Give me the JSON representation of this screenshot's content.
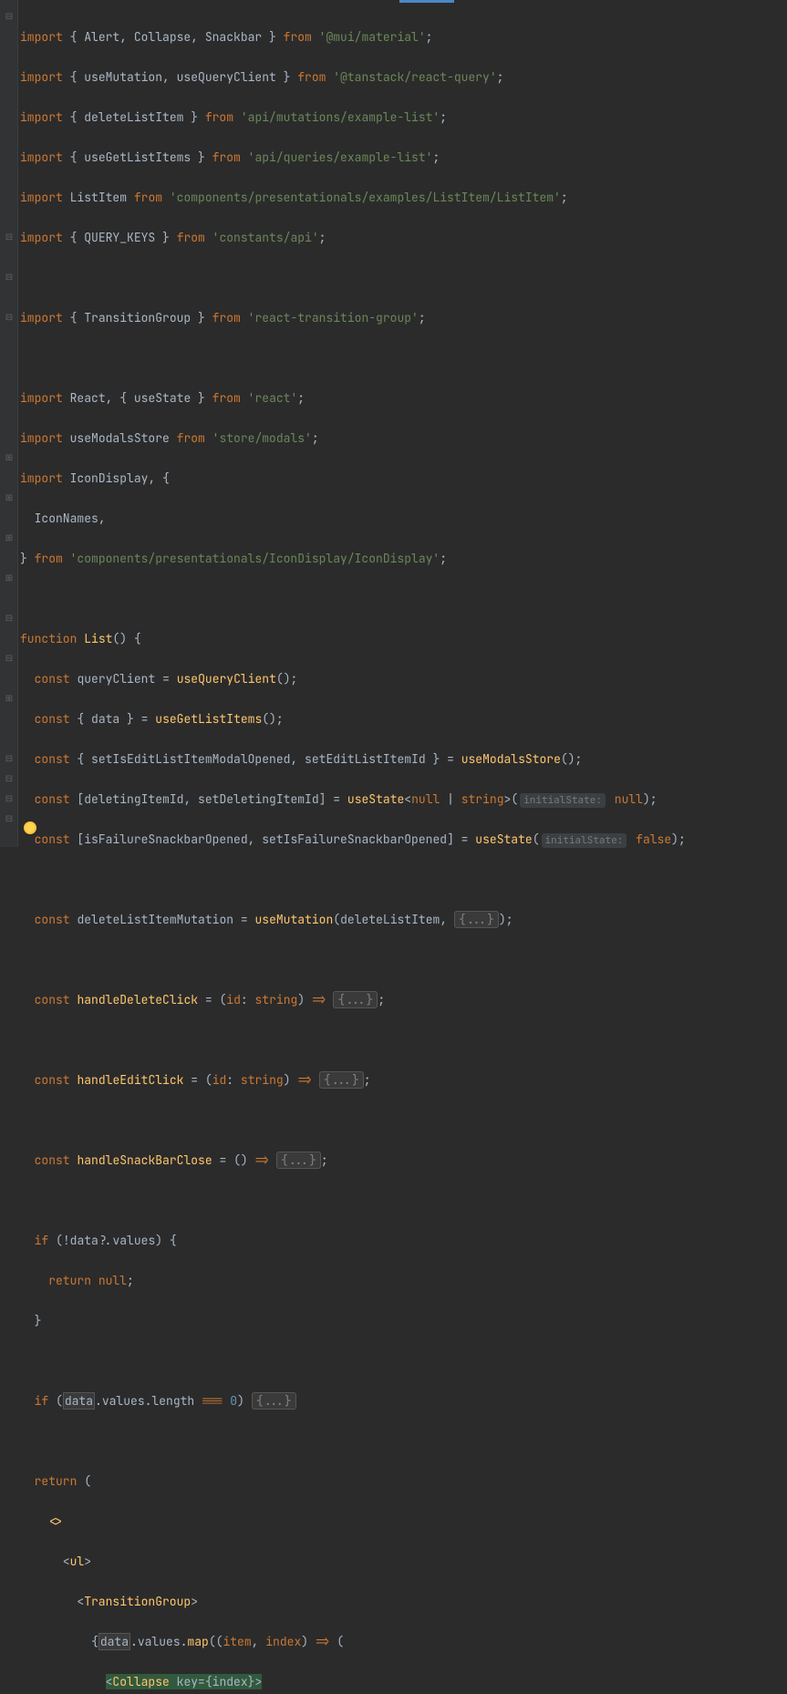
{
  "imports": [
    {
      "names": "Alert, Collapse, Snackbar",
      "path": "'@mui/material'",
      "braces": true
    },
    {
      "names": "useMutation, useQueryClient",
      "path": "'@tanstack/react-query'",
      "braces": true
    },
    {
      "names": "deleteListItem",
      "path": "'api/mutations/example-list'",
      "braces": true
    },
    {
      "names": "useGetListItems",
      "path": "'api/queries/example-list'",
      "braces": true
    },
    {
      "default": "ListItem",
      "path": "'components/presentationals/examples/ListItem/ListItem'"
    },
    {
      "names": "QUERY_KEYS",
      "path": "'constants/api'",
      "braces": true
    }
  ],
  "import_transition": {
    "names": "TransitionGroup",
    "path": "'react-transition-group'",
    "braces": true
  },
  "import_react": {
    "default": "React",
    "names": "useState",
    "path": "'react'"
  },
  "import_modals": {
    "default": "useModalsStore",
    "path": "'store/modals'"
  },
  "import_icondisplay": {
    "default": "IconDisplay",
    "names": "IconNames",
    "path": "'components/presentationals/IconDisplay/IconDisplay'"
  },
  "fn_decl": "function",
  "fn_name": "List",
  "consts": {
    "c1": {
      "kw": "const",
      "name": "queryClient",
      "assign": "=",
      "call": "useQueryClient"
    },
    "c2": {
      "kw": "const",
      "destruct": "data",
      "assign": "=",
      "call": "useGetListItems"
    },
    "c3": {
      "kw": "const",
      "d1": "setIsEditListItemModalOpened",
      "d2": "setEditListItemId",
      "assign": "=",
      "call": "useModalsStore"
    },
    "c4": {
      "kw": "const",
      "d1": "deletingItemId",
      "d2": "setDeletingItemId",
      "assign": "=",
      "call": "useState",
      "gen1": "null",
      "gen2": "string",
      "hint": "initialState:",
      "val": "null"
    },
    "c5": {
      "kw": "const",
      "d1": "isFailureSnackbarOpened",
      "d2": "setIsFailureSnackbarOpened",
      "assign": "=",
      "call": "useState",
      "hint": "initialState:",
      "val": "false"
    },
    "c6": {
      "kw": "const",
      "name": "deleteListItemMutation",
      "assign": "=",
      "call": "useMutation",
      "arg": "deleteListItem",
      "fold": "{...}"
    },
    "c7": {
      "kw": "const",
      "name": "handleDeleteClick",
      "assign": "=",
      "param": "id",
      "ptype": "string",
      "arrow": "=>",
      "fold": "{...}"
    },
    "c8": {
      "kw": "const",
      "name": "handleEditClick",
      "assign": "=",
      "param": "id",
      "ptype": "string",
      "arrow": "=>",
      "fold": "{...}"
    },
    "c9": {
      "kw": "const",
      "name": "handleSnackBarClose",
      "assign": "=",
      "arrow": "=>",
      "fold": "{...}"
    }
  },
  "if1": {
    "kw": "if",
    "cond_neg": "!",
    "obj": "data",
    "chain": "?.values",
    "ret": "return",
    "val": "null"
  },
  "if2": {
    "kw": "if",
    "obj": "data",
    "chain": ".values.length",
    "op": "===",
    "num": "0",
    "fold": "{...}"
  },
  "ret": {
    "kw": "return"
  },
  "jsx": {
    "frag": "<>",
    "ul": "ul",
    "tg": "TransitionGroup",
    "map_obj": "data",
    "map_chain": ".values.",
    "map_fn": "map",
    "p1": "item",
    "p2": "index",
    "arrow": "=>",
    "collapse": "Collapse",
    "key": "key",
    "keyval": "index"
  }
}
